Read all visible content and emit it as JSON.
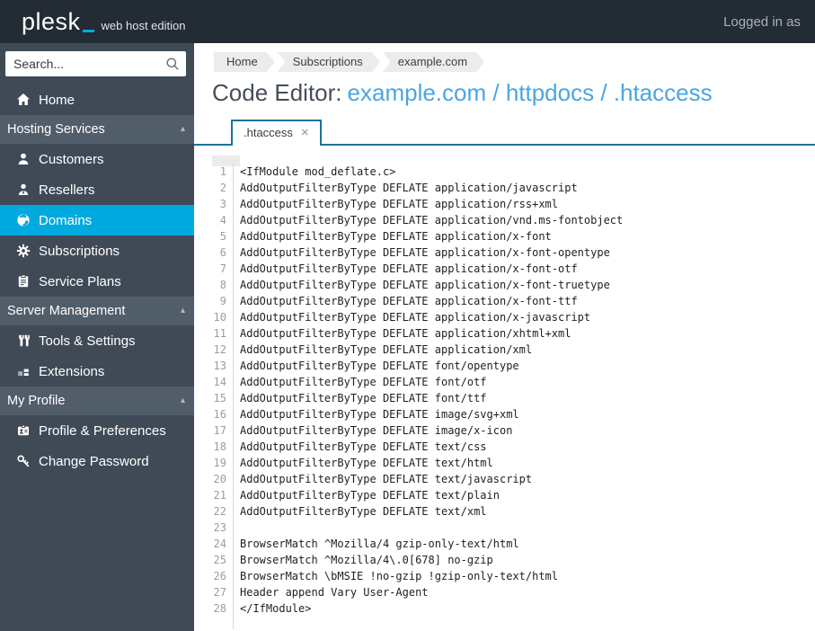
{
  "topbar": {
    "logo_text": "plesk",
    "logo_suffix": "web host edition",
    "logged_in_label": "Logged in as"
  },
  "sidebar": {
    "search_placeholder": "Search...",
    "groups": [
      {
        "type": "item",
        "label": "Home",
        "icon": "home-icon",
        "selected": false
      },
      {
        "type": "section",
        "label": "Hosting Services",
        "collapse_icon": "chevron-up-icon",
        "items": [
          {
            "label": "Customers",
            "icon": "customer-icon",
            "selected": false
          },
          {
            "label": "Resellers",
            "icon": "reseller-icon",
            "selected": false
          },
          {
            "label": "Domains",
            "icon": "globe-icon",
            "selected": true
          },
          {
            "label": "Subscriptions",
            "icon": "gear-icon",
            "selected": false
          },
          {
            "label": "Service Plans",
            "icon": "clipboard-icon",
            "selected": false
          }
        ]
      },
      {
        "type": "section",
        "label": "Server Management",
        "collapse_icon": "chevron-up-icon",
        "items": [
          {
            "label": "Tools & Settings",
            "icon": "tools-icon",
            "selected": false
          },
          {
            "label": "Extensions",
            "icon": "blocks-icon",
            "selected": false
          }
        ]
      },
      {
        "type": "section",
        "label": "My Profile",
        "collapse_icon": "chevron-up-icon",
        "items": [
          {
            "label": "Profile & Preferences",
            "icon": "id-card-icon",
            "selected": false
          },
          {
            "label": "Change Password",
            "icon": "key-icon",
            "selected": false
          }
        ]
      }
    ]
  },
  "breadcrumb": {
    "items": [
      "Home",
      "Subscriptions",
      "example.com"
    ]
  },
  "page": {
    "title_prefix": "Code Editor:",
    "title_path": "example.com / httpdocs / .htaccess"
  },
  "editor": {
    "tab_label": ".htaccess",
    "tab_close": "×",
    "lines": [
      "<IfModule mod_deflate.c>",
      "AddOutputFilterByType DEFLATE application/javascript",
      "AddOutputFilterByType DEFLATE application/rss+xml",
      "AddOutputFilterByType DEFLATE application/vnd.ms-fontobject",
      "AddOutputFilterByType DEFLATE application/x-font",
      "AddOutputFilterByType DEFLATE application/x-font-opentype",
      "AddOutputFilterByType DEFLATE application/x-font-otf",
      "AddOutputFilterByType DEFLATE application/x-font-truetype",
      "AddOutputFilterByType DEFLATE application/x-font-ttf",
      "AddOutputFilterByType DEFLATE application/x-javascript",
      "AddOutputFilterByType DEFLATE application/xhtml+xml",
      "AddOutputFilterByType DEFLATE application/xml",
      "AddOutputFilterByType DEFLATE font/opentype",
      "AddOutputFilterByType DEFLATE font/otf",
      "AddOutputFilterByType DEFLATE font/ttf",
      "AddOutputFilterByType DEFLATE image/svg+xml",
      "AddOutputFilterByType DEFLATE image/x-icon",
      "AddOutputFilterByType DEFLATE text/css",
      "AddOutputFilterByType DEFLATE text/html",
      "AddOutputFilterByType DEFLATE text/javascript",
      "AddOutputFilterByType DEFLATE text/plain",
      "AddOutputFilterByType DEFLATE text/xml",
      "",
      "BrowserMatch ^Mozilla/4 gzip-only-text/html",
      "BrowserMatch ^Mozilla/4\\.0[678] no-gzip",
      "BrowserMatch \\bMSIE !no-gzip !gzip-only-text/html",
      "Header append Vary User-Agent",
      "</IfModule>"
    ]
  },
  "colors": {
    "accent": "#00aadf",
    "sidebar_bg": "#404a57",
    "section_bg": "#525d6a",
    "topbar_bg": "#232b34",
    "tab_border": "#19739e",
    "link_blue": "#4aa6e2"
  }
}
